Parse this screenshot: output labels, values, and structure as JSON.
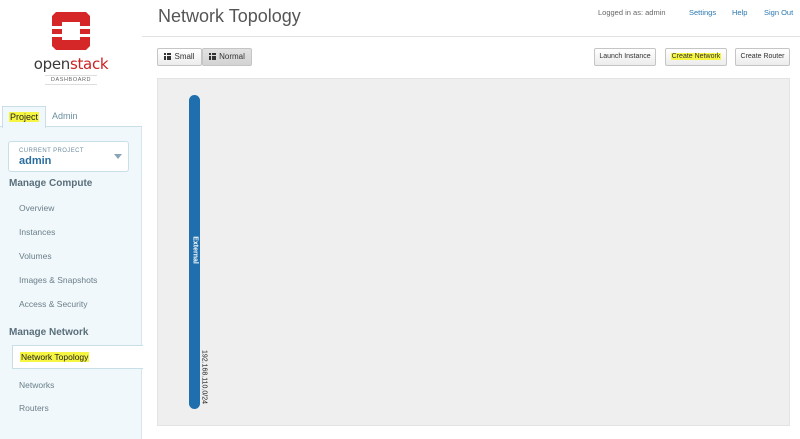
{
  "colors": {
    "accent": "#1f6fae",
    "highlight": "#f5f542",
    "brand_red": "#cc2222"
  },
  "logo": {
    "wordmark": "openstack",
    "sub": "DASHBOARD",
    "icon": "openstack-cube-icon"
  },
  "header": {
    "title": "Network Topology",
    "logged_in": "Logged in as: admin",
    "settings": "Settings",
    "help": "Help",
    "sign_out": "Sign Out"
  },
  "sidebar": {
    "tabs": [
      {
        "label": "Project",
        "active": true
      },
      {
        "label": "Admin",
        "active": false
      }
    ],
    "project_selector": {
      "caption": "CURRENT PROJECT",
      "value": "admin"
    },
    "sections": [
      {
        "title": "Manage Compute",
        "items": [
          "Overview",
          "Instances",
          "Volumes",
          "Images & Snapshots",
          "Access & Security"
        ]
      },
      {
        "title": "Manage Network",
        "items": [
          "Network Topology",
          "Networks",
          "Routers"
        ],
        "active": "Network Topology"
      }
    ]
  },
  "toolbar": {
    "small": "Small",
    "normal": "Normal",
    "view_selected": "Normal",
    "launch_instance": "Launch Instance",
    "create_network": "Create Network",
    "create_router": "Create Router"
  },
  "topology": {
    "networks": [
      {
        "name": "External",
        "cidr": "192.168.110.0/24"
      }
    ]
  }
}
